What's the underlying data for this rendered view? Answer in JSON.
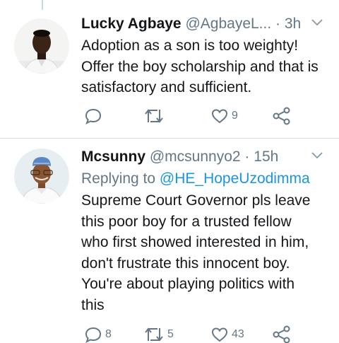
{
  "tweets": [
    {
      "name": "Lucky Agbaye",
      "handle": "@AgbayeL...",
      "dot": "·",
      "time": "3h",
      "replying_to_label": "",
      "replying_to_handle": "",
      "body_lines": [
        "Adoption as a son is too weighty!",
        "Offer the boy scholarship and that is",
        "satisfactory and sufficient."
      ],
      "counts": {
        "reply": "",
        "retweet": "",
        "like": "9"
      }
    },
    {
      "name": "Mcsunny",
      "handle": "@mcsunnyo2",
      "dot": "·",
      "time": "15h",
      "replying_to_label": "Replying to",
      "replying_to_handle": "@HE_HopeUzodimma",
      "body_lines": [
        "Supreme Court Governor pls leave",
        "this poor boy for a trusted fellow",
        "who first showed interested in him,",
        "don't frustrate this innocent boy.",
        "You're about playing politics with",
        "this"
      ],
      "counts": {
        "reply": "8",
        "retweet": "5",
        "like": "43"
      }
    }
  ],
  "icons": {
    "reply": "reply-icon",
    "retweet": "retweet-icon",
    "like": "heart-icon",
    "share": "share-icon",
    "caret": "chevron-down-icon"
  },
  "colors": {
    "text": "#14171a",
    "secondary": "#657786",
    "link": "#1b95e0",
    "divider": "#d8dde1"
  }
}
